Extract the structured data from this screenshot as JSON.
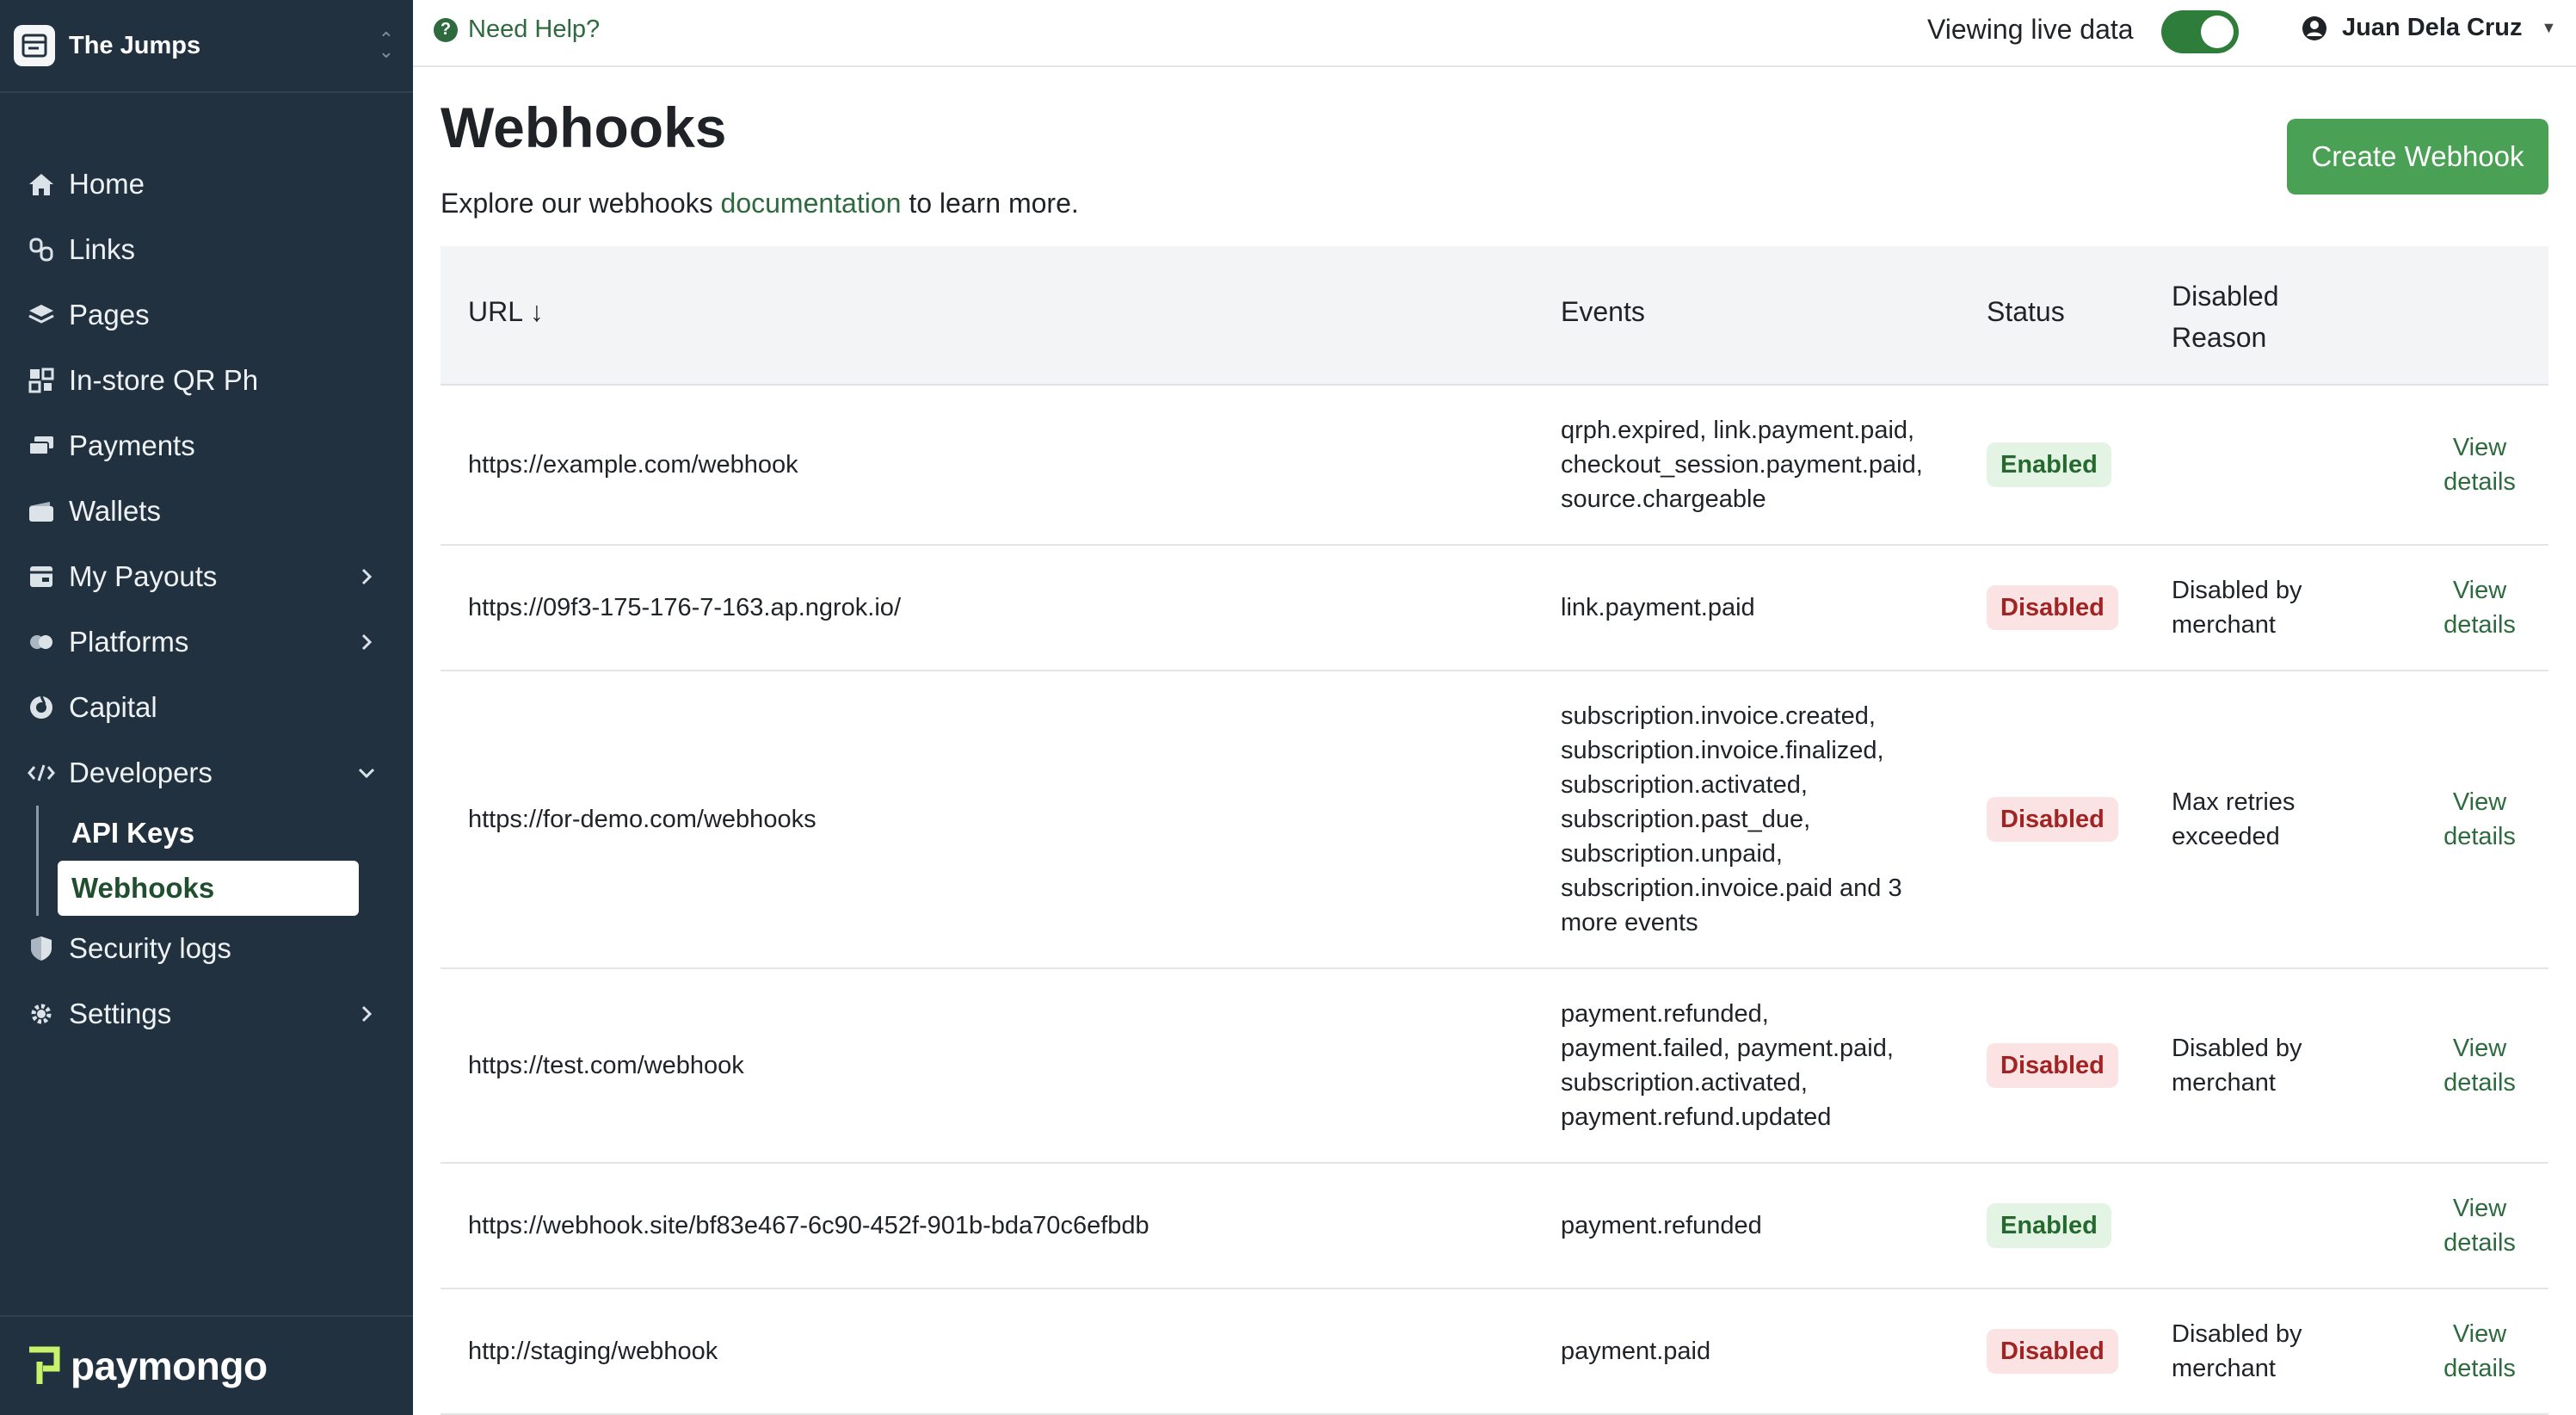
{
  "sidebar": {
    "brand_name": "The Jumps",
    "items": [
      {
        "label": "Home",
        "icon": "home-icon"
      },
      {
        "label": "Links",
        "icon": "link-icon"
      },
      {
        "label": "Pages",
        "icon": "layers-icon"
      },
      {
        "label": "In-store QR Ph",
        "icon": "qr-icon"
      },
      {
        "label": "Payments",
        "icon": "payments-icon"
      },
      {
        "label": "Wallets",
        "icon": "wallet-icon"
      },
      {
        "label": "My Payouts",
        "icon": "payouts-icon"
      },
      {
        "label": "Platforms",
        "icon": "platforms-icon"
      },
      {
        "label": "Capital",
        "icon": "capital-icon"
      },
      {
        "label": "Developers",
        "icon": "code-icon"
      },
      {
        "label": "Security logs",
        "icon": "shield-icon"
      },
      {
        "label": "Settings",
        "icon": "gear-icon"
      }
    ],
    "developer_sub": [
      {
        "label": "API Keys"
      },
      {
        "label": "Webhooks"
      }
    ],
    "footer_logo": "paymongo"
  },
  "topbar": {
    "help_label": "Need Help?",
    "live_label": "Viewing live data",
    "live_on": true,
    "user_name": "Juan Dela Cruz"
  },
  "main": {
    "title": "Webhooks",
    "subtitle_prefix": "Explore our webhooks ",
    "subtitle_link": "documentation",
    "subtitle_suffix": " to learn more.",
    "create_button": "Create Webhook"
  },
  "table": {
    "headers": {
      "url": "URL ↓",
      "events": "Events",
      "status": "Status",
      "reason_line1": "Disabled",
      "reason_line2": "Reason"
    },
    "rows": [
      {
        "url": "https://example.com/webhook",
        "events": [
          "qrph.expired, link.payment.paid,",
          "checkout_session.payment.paid,",
          "source.chargeable"
        ],
        "status": "Enabled",
        "reason": [
          "",
          ""
        ],
        "action": [
          "View",
          "details"
        ]
      },
      {
        "url": "https://09f3-175-176-7-163.ap.ngrok.io/",
        "events": [
          "link.payment.paid"
        ],
        "status": "Disabled",
        "reason": [
          "Disabled by",
          "merchant"
        ],
        "action": [
          "View",
          "details"
        ]
      },
      {
        "url": "https://for-demo.com/webhooks",
        "events": [
          "subscription.invoice.created,",
          "subscription.invoice.finalized,",
          "subscription.activated,",
          "subscription.past_due,",
          "subscription.unpaid,",
          "subscription.invoice.paid and 3",
          "more events"
        ],
        "status": "Disabled",
        "reason": [
          "Max retries",
          "exceeded"
        ],
        "action": [
          "View",
          "details"
        ]
      },
      {
        "url": "https://test.com/webhook",
        "events": [
          "payment.refunded,",
          "payment.failed, payment.paid,",
          "subscription.activated,",
          "payment.refund.updated"
        ],
        "status": "Disabled",
        "reason": [
          "Disabled by",
          "merchant"
        ],
        "action": [
          "View",
          "details"
        ]
      },
      {
        "url": "https://webhook.site/bf83e467-6c90-452f-901b-bda70c6efbdb",
        "events": [
          "payment.refunded"
        ],
        "status": "Enabled",
        "reason": [
          "",
          ""
        ],
        "action": [
          "View",
          "details"
        ]
      },
      {
        "url": "http://staging/webhook",
        "events": [
          "payment.paid"
        ],
        "status": "Disabled",
        "reason": [
          "Disabled by",
          "merchant"
        ],
        "action": [
          "View",
          "details"
        ]
      }
    ]
  },
  "colors": {
    "sidebar_bg": "#213140",
    "accent_green": "#2d6a3e",
    "button_green": "#4aa055",
    "enabled_bg": "#e3f4e5",
    "disabled_bg": "#fbe3e3"
  }
}
